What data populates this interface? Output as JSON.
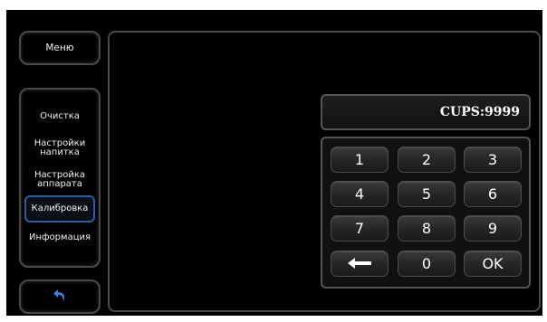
{
  "sidebar": {
    "menu_label": "Меню",
    "items": [
      {
        "label": "Очистка",
        "active": false
      },
      {
        "label": "Настройки\nнапитка",
        "active": false
      },
      {
        "label": "Настройка\nаппарата",
        "active": false
      },
      {
        "label": "Калибровка",
        "active": true
      },
      {
        "label": "Информация",
        "active": false
      }
    ],
    "back_icon": "back-arrow-icon"
  },
  "display": {
    "value": "CUPS:9999"
  },
  "keypad": {
    "keys": [
      "1",
      "2",
      "3",
      "4",
      "5",
      "6",
      "7",
      "8",
      "9",
      "←",
      "0",
      "OK"
    ]
  },
  "colors": {
    "background": "#000000",
    "panel_border": "#4a4a4a",
    "active_border": "#2e5d9e",
    "back_icon": "#3b7fd8"
  }
}
